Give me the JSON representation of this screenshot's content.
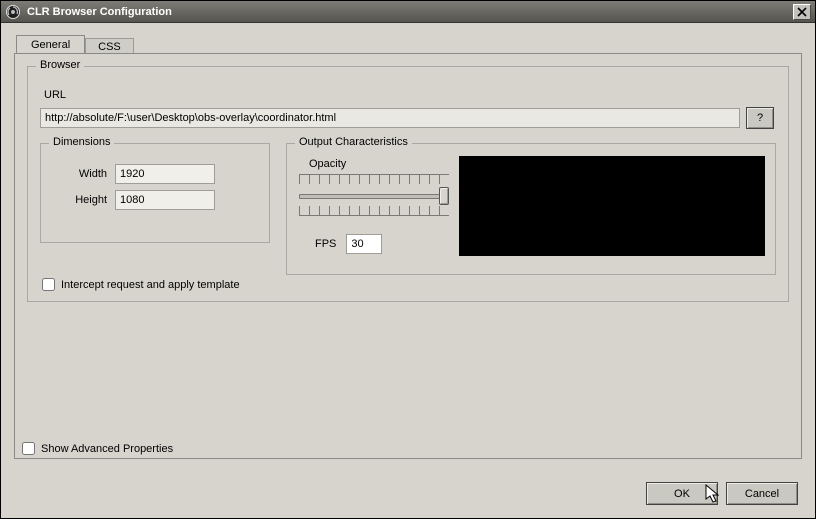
{
  "window": {
    "title": "CLR Browser Configuration",
    "close_x": "✕"
  },
  "tabs": {
    "general": "General",
    "css": "CSS"
  },
  "browser": {
    "legend": "Browser",
    "url_label": "URL",
    "url_value": "http://absolute/F:\\user\\Desktop\\obs-overlay\\coordinator.html",
    "help_btn": "?",
    "dimensions": {
      "legend": "Dimensions",
      "width_label": "Width",
      "width_value": "1920",
      "height_label": "Height",
      "height_value": "1080"
    },
    "output": {
      "legend": "Output Characteristics",
      "opacity_label": "Opacity",
      "fps_label": "FPS",
      "fps_value": "30"
    },
    "intercept_label": "Intercept request and apply template"
  },
  "advanced_label": "Show Advanced Properties",
  "buttons": {
    "ok": "OK",
    "cancel": "Cancel"
  }
}
